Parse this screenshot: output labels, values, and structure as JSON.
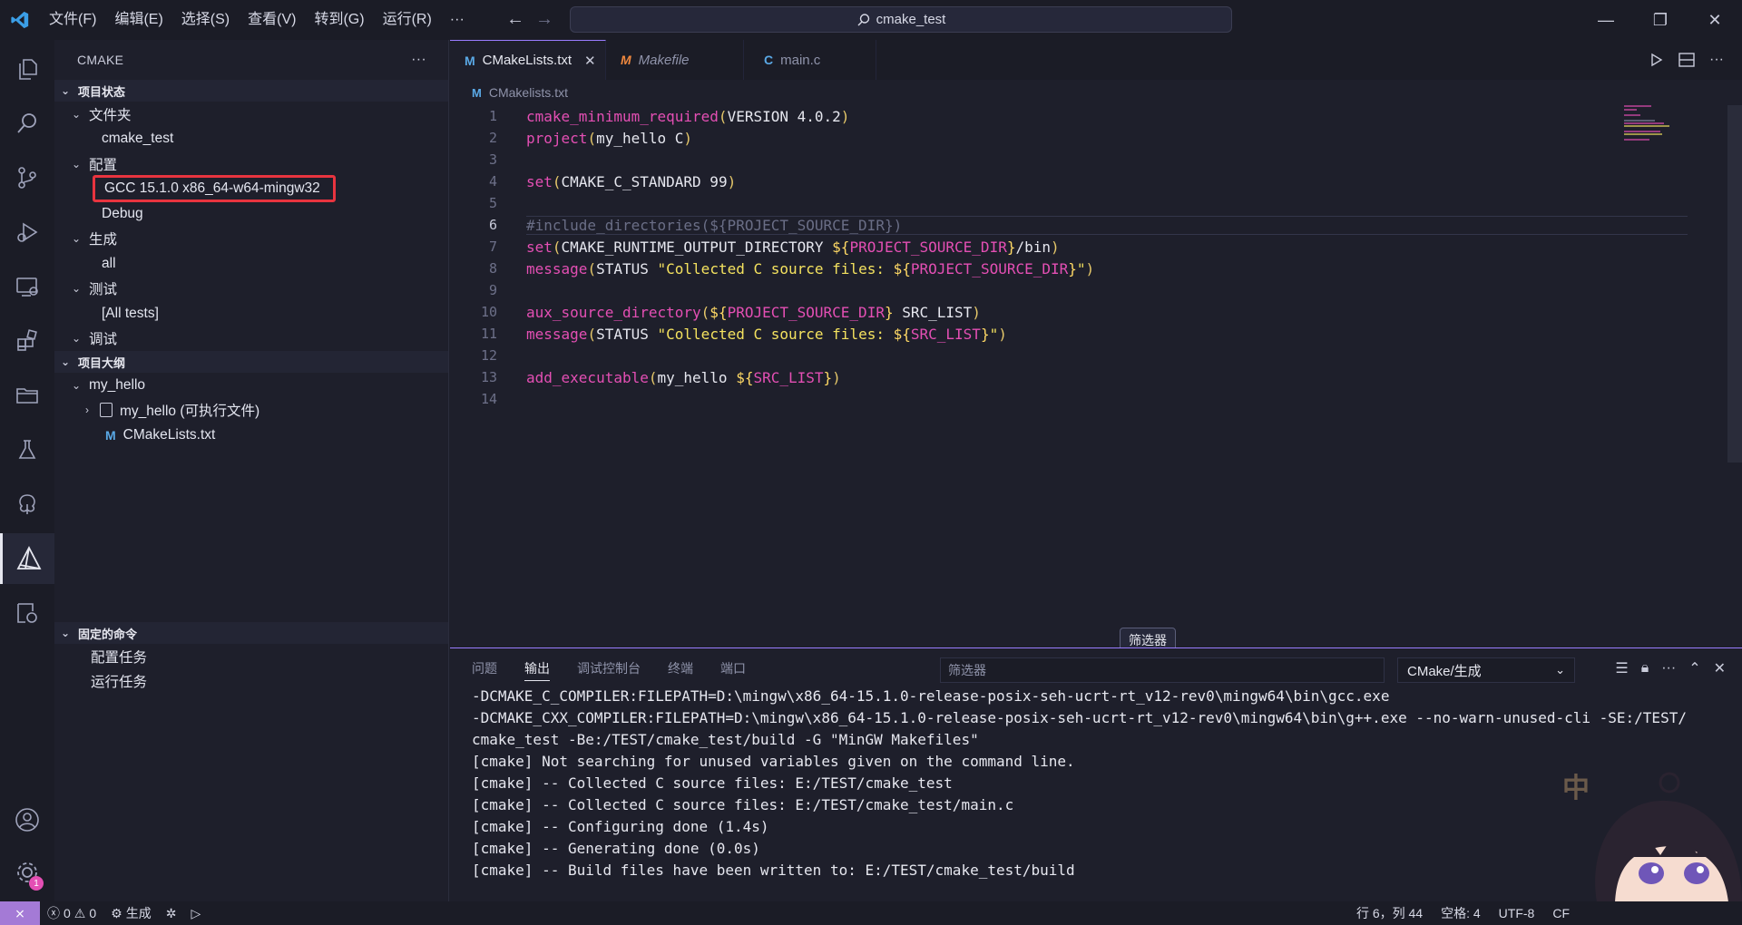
{
  "menu": [
    "文件(F)",
    "编辑(E)",
    "选择(S)",
    "查看(V)",
    "转到(G)",
    "运行(R)",
    "···"
  ],
  "search": {
    "text": "cmake_test"
  },
  "sidebar": {
    "title": "CMAKE",
    "more": "···",
    "sections": {
      "status": "项目状态",
      "folder": "文件夹",
      "folder_value": "cmake_test",
      "config": "配置",
      "config_compiler": "GCC 15.1.0 x86_64-w64-mingw32",
      "config_type": "Debug",
      "build": "生成",
      "build_target": "all",
      "test": "测试",
      "test_target": "[All tests]",
      "debug": "调试",
      "outline": "项目大纲",
      "outline_project": "my_hello",
      "outline_exe": "my_hello (可执行文件)",
      "outline_cmake": "CMakeLists.txt",
      "pinned": "固定的命令",
      "pinned_config": "配置任务",
      "pinned_run": "运行任务"
    }
  },
  "tabs": [
    {
      "icon": "M",
      "label": "CMakeLists.txt"
    },
    {
      "icon": "M",
      "label": "Makefile"
    },
    {
      "icon": "C",
      "label": "main.c"
    }
  ],
  "breadcrumb": "CMakelists.txt",
  "code_lines": [
    "cmake_minimum_required(VERSION 4.0.2)",
    "project(my_hello C)",
    "",
    "set(CMAKE_C_STANDARD 99)",
    "",
    "#include_directories(${PROJECT_SOURCE_DIR})",
    "set(CMAKE_RUNTIME_OUTPUT_DIRECTORY ${PROJECT_SOURCE_DIR}/bin)",
    "message(STATUS \"Collected C source files: ${PROJECT_SOURCE_DIR}\")",
    "",
    "aux_source_directory(${PROJECT_SOURCE_DIR} SRC_LIST)",
    "message(STATUS \"Collected C source files: ${SRC_LIST}\")",
    "",
    "add_executable(my_hello ${SRC_LIST})",
    ""
  ],
  "tooltip": "筛选器",
  "panel": {
    "tabs": [
      "问题",
      "输出",
      "调试控制台",
      "终端",
      "端口"
    ],
    "filter_placeholder": "筛选器",
    "output_channel": "CMake/生成",
    "output_lines": [
      "-DCMAKE_C_COMPILER:FILEPATH=D:\\mingw\\x86_64-15.1.0-release-posix-seh-ucrt-rt_v12-rev0\\mingw64\\bin\\gcc.exe",
      "-DCMAKE_CXX_COMPILER:FILEPATH=D:\\mingw\\x86_64-15.1.0-release-posix-seh-ucrt-rt_v12-rev0\\mingw64\\bin\\g++.exe --no-warn-unused-cli -SE:/TEST/",
      "cmake_test -Be:/TEST/cmake_test/build -G \"MinGW Makefiles\"",
      "[cmake] Not searching for unused variables given on the command line.",
      "[cmake] -- Collected C source files: E:/TEST/cmake_test",
      "[cmake] -- Collected C source files: E:/TEST/cmake_test/main.c",
      "[cmake] -- Configuring done (1.4s)",
      "[cmake] -- Generating done (0.0s)",
      "[cmake] -- Build files have been written to: E:/TEST/cmake_test/build"
    ]
  },
  "statusbar": {
    "errors": "0",
    "warnings": "0",
    "build": "生成",
    "position": "行 6，列 44",
    "spaces": "空格: 4",
    "encoding": "UTF-8",
    "eol": "CF",
    "badge": "1"
  },
  "mascot_text": "中",
  "colors": {
    "accent": "#9a7cff",
    "highlight": "#e8343f",
    "string": "#f4e25f",
    "keyword": "#e44fb4"
  }
}
